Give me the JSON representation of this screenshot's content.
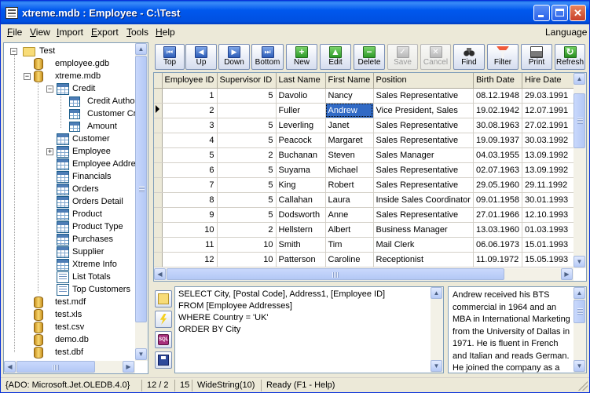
{
  "window": {
    "title": "xtreme.mdb : Employee - C:\\Test"
  },
  "menu": {
    "file": {
      "key": "F",
      "rest": "ile"
    },
    "view": {
      "key": "V",
      "rest": "iew"
    },
    "import": {
      "key": "I",
      "rest": "mport"
    },
    "export": {
      "key": "E",
      "rest": "xport"
    },
    "tools": {
      "key": "T",
      "rest": "ools"
    },
    "help": {
      "key": "H",
      "rest": "elp"
    },
    "language": "Language"
  },
  "tree": {
    "root": "Test",
    "employee_gdb": "employee.gdb",
    "xtreme_mdb": "xtreme.mdb",
    "credit": "Credit",
    "credit_fields": [
      "Credit Authorization Number",
      "Customer Credit ID",
      "Amount"
    ],
    "tables": [
      "Customer",
      "Employee",
      "Employee Addresses",
      "Financials",
      "Orders",
      "Orders Detail",
      "Product",
      "Product Type",
      "Purchases",
      "Supplier",
      "Xtreme Info",
      "List Totals",
      "Top Customers"
    ],
    "files": [
      "test.mdf",
      "test.xls",
      "test.csv",
      "demo.db",
      "test.dbf"
    ]
  },
  "toolbar": {
    "top": "Top",
    "up": "Up",
    "down": "Down",
    "bottom": "Bottom",
    "new": "New",
    "edit": "Edit",
    "delete": "Delete",
    "save": "Save",
    "cancel": "Cancel",
    "find": "Find",
    "filter": "Filter",
    "print": "Print",
    "refresh": "Refresh"
  },
  "grid": {
    "columns": [
      "Employee ID",
      "Supervisor ID",
      "Last Name",
      "First Name",
      "Position",
      "Birth Date",
      "Hire Date"
    ],
    "rows": [
      [
        "1",
        "5",
        "Davolio",
        "Nancy",
        "Sales Representative",
        "08.12.1948",
        "29.03.1991"
      ],
      [
        "2",
        "",
        "Fuller",
        "Andrew",
        "Vice President, Sales",
        "19.02.1942",
        "12.07.1991"
      ],
      [
        "3",
        "5",
        "Leverling",
        "Janet",
        "Sales Representative",
        "30.08.1963",
        "27.02.1991"
      ],
      [
        "4",
        "5",
        "Peacock",
        "Margaret",
        "Sales Representative",
        "19.09.1937",
        "30.03.1992"
      ],
      [
        "5",
        "2",
        "Buchanan",
        "Steven",
        "Sales Manager",
        "04.03.1955",
        "13.09.1992"
      ],
      [
        "6",
        "5",
        "Suyama",
        "Michael",
        "Sales Representative",
        "02.07.1963",
        "13.09.1992"
      ],
      [
        "7",
        "5",
        "King",
        "Robert",
        "Sales Representative",
        "29.05.1960",
        "29.11.1992"
      ],
      [
        "8",
        "5",
        "Callahan",
        "Laura",
        "Inside Sales Coordinator",
        "09.01.1958",
        "30.01.1993"
      ],
      [
        "9",
        "5",
        "Dodsworth",
        "Anne",
        "Sales Representative",
        "27.01.1966",
        "12.10.1993"
      ],
      [
        "10",
        "2",
        "Hellstern",
        "Albert",
        "Business Manager",
        "13.03.1960",
        "01.03.1993"
      ],
      [
        "11",
        "10",
        "Smith",
        "Tim",
        "Mail Clerk",
        "06.06.1973",
        "15.01.1993"
      ],
      [
        "12",
        "10",
        "Patterson",
        "Caroline",
        "Receptionist",
        "11.09.1972",
        "15.05.1993"
      ]
    ]
  },
  "sql": {
    "lines": [
      "SELECT City, [Postal Code], Address1, [Employee ID]",
      "FROM [Employee Addresses]",
      "WHERE Country = 'UK'",
      "ORDER BY City"
    ]
  },
  "note": {
    "text": "Andrew received his BTS commercial in 1964 and an MBA in International Marketing from the University of Dallas in 1971.  He is fluent in French and Italian and reads German. He joined the company as a"
  },
  "status": {
    "connection": "{ADO: Microsoft.Jet.OLEDB.4.0}",
    "record": "12 / 2",
    "size": "15",
    "type": "WideString(10)",
    "state": "Ready (F1 - Help)"
  },
  "colors": {
    "titlebar": "#0058EE",
    "selection": "#316AC5",
    "face": "#ECE9D8"
  }
}
